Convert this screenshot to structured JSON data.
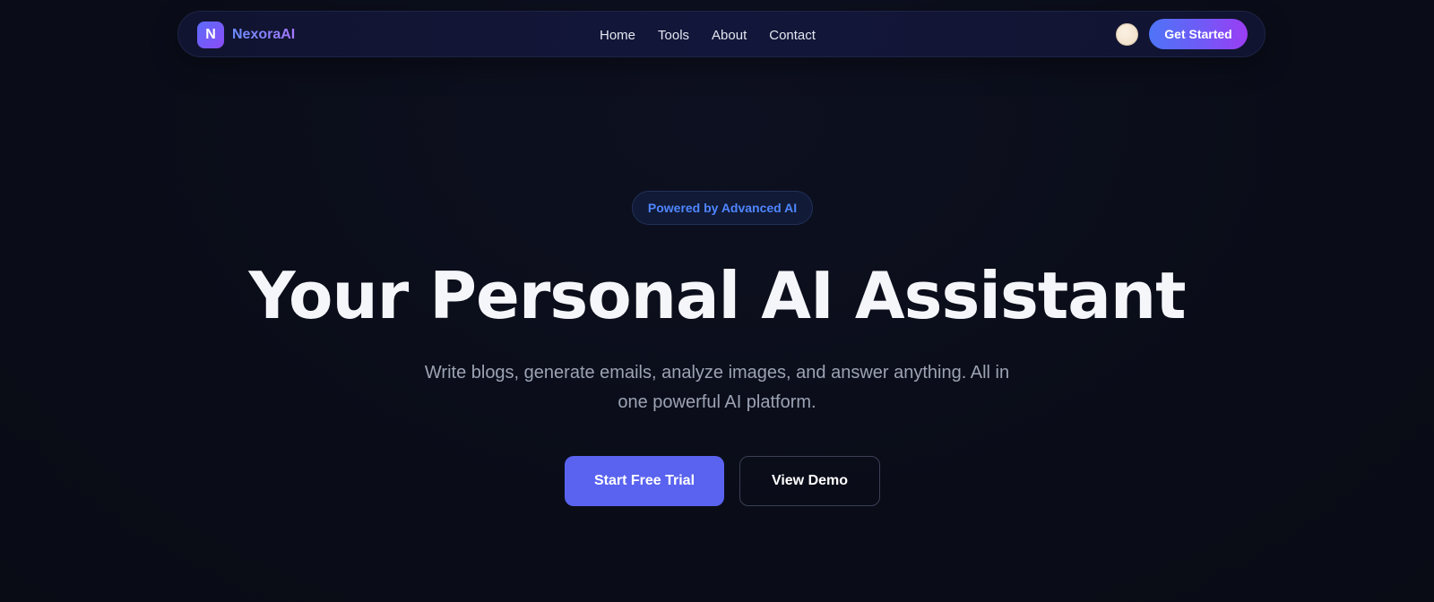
{
  "navbar": {
    "brand": {
      "logo_letter": "N",
      "name": "NexoraAI"
    },
    "links": [
      {
        "label": "Home"
      },
      {
        "label": "Tools"
      },
      {
        "label": "About"
      },
      {
        "label": "Contact"
      }
    ],
    "avatar_icon": "user-avatar",
    "cta_label": "Get Started"
  },
  "hero": {
    "badge": "Powered by Advanced AI",
    "title": "Your Personal AI Assistant",
    "subtitle": "Write blogs, generate emails, analyze images, and answer anything. All in one powerful AI platform.",
    "primary_button": "Start Free Trial",
    "secondary_button": "View Demo"
  },
  "colors": {
    "background": "#0b0e1a",
    "accent": "#5a63ef",
    "gradient_start": "#4f74f7",
    "gradient_end": "#9b3df4",
    "badge_text": "#4f86ff"
  }
}
